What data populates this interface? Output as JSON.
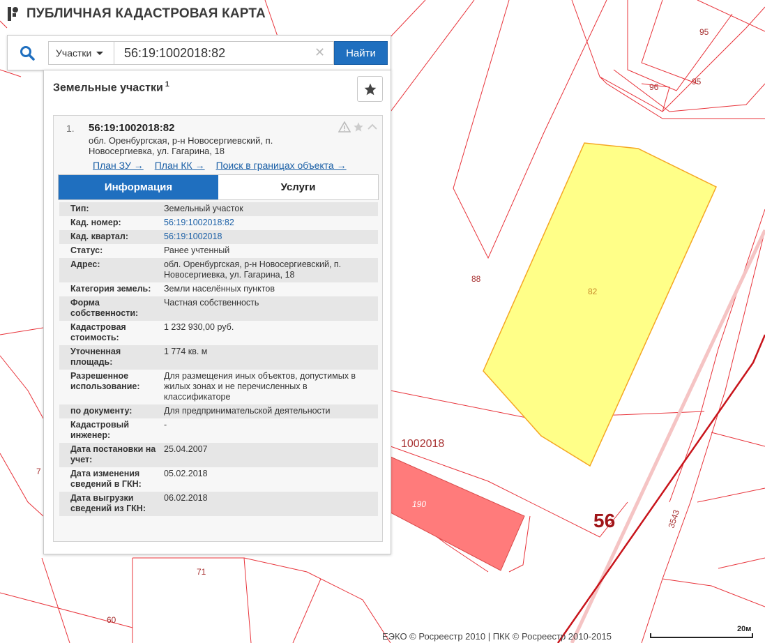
{
  "app": {
    "title": "ПУБЛИЧНАЯ КАДАСТРОВАЯ КАРТА"
  },
  "search": {
    "type_label": "Участки",
    "value": "56:19:1002018:82",
    "find_label": "Найти"
  },
  "panel": {
    "title": "Земельные участки",
    "count": "1"
  },
  "card": {
    "index": "1.",
    "cad_number": "56:19:1002018:82",
    "address": "обл. Оренбургская, р-н Новосергиевский, п. Новосергиевка, ул. Гагарина, 18",
    "links": [
      "План ЗУ →",
      "План КК →",
      "Поиск в границах объекта →"
    ],
    "tabs": [
      "Информация",
      "Услуги"
    ],
    "active_tab": "Информация"
  },
  "info_rows": [
    {
      "key": "Тип:",
      "value": "Земельный участок"
    },
    {
      "key": "Кад. номер:",
      "value": "56:19:1002018:82"
    },
    {
      "key": "Кад. квартал:",
      "value": "56:19:1002018"
    },
    {
      "key": "Статус:",
      "value": "Ранее учтенный"
    },
    {
      "key": "Адрес:",
      "value": "обл. Оренбургская, р-н Новосергиевский, п. Новосергиевка, ул. Гагарина, 18"
    },
    {
      "key": "Категория земель:",
      "value": "Земли населённых пунктов"
    },
    {
      "key": "Форма собственности:",
      "value": "Частная собственность"
    },
    {
      "key": "Кадастровая стоимость:",
      "value": "1 232 930,00 руб."
    },
    {
      "key": "Уточненная площадь:",
      "value": "1 774 кв. м"
    },
    {
      "key": "Разрешенное использование:",
      "value": "Для размещения иных объектов, допустимых в жилых зонах и не перечисленных в классификаторе"
    },
    {
      "key": "по документу:",
      "value": "Для предпринимательской деятельности"
    },
    {
      "key": "Кадастровый инженер:",
      "value": "-"
    },
    {
      "key": "Дата постановки на учет:",
      "value": "25.04.2007"
    },
    {
      "key": "Дата изменения сведений в ГКН:",
      "value": "05.02.2018"
    },
    {
      "key": "Дата выгрузки сведений из ГКН:",
      "value": "06.02.2018"
    }
  ],
  "map": {
    "parcel_labels": {
      "p95a": "95",
      "p95b": "95",
      "p96": "96",
      "p88": "88",
      "p82": "82",
      "p190": "190",
      "p71": "71",
      "p60": "60",
      "p7": "7",
      "p3543": "3543"
    },
    "quarter_label": "1002018",
    "district_label": "56",
    "attribution": "ЕЭКО © Росреестр 2010 | ПКК © Росреестр 2010-2015",
    "scale_label": "20м",
    "colors": {
      "parcel_line": "#e8333a",
      "selected_fill": "#ffff88",
      "selected_line": "#f5a623",
      "building_fill": "#ff7b7b",
      "district_line": "#c8141b",
      "label": "#a83232",
      "accent": "#1f6fbf"
    }
  }
}
